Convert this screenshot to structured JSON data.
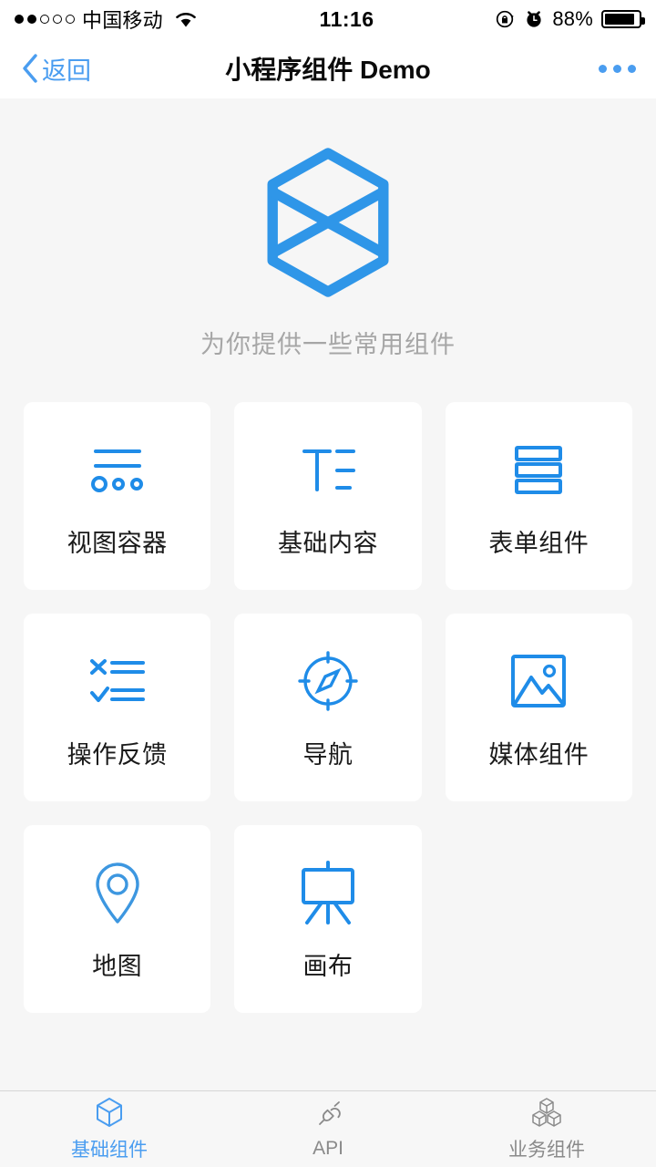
{
  "colors": {
    "accent": "#1f8ce8",
    "nav_link": "#4a9df0",
    "page_bg": "#f6f6f6",
    "card_bg": "#ffffff",
    "tagline": "#a6a6a6",
    "tab_inactive": "#8a8a8a"
  },
  "statusbar": {
    "signal_dots_filled": 2,
    "signal_dots_total": 5,
    "carrier": "中国移动",
    "wifi_icon": "wifi-icon",
    "time": "11:16",
    "rotation_lock_icon": "rotation-lock-icon",
    "alarm_icon": "alarm-clock-icon",
    "battery_percent": "88%",
    "battery_level": 88,
    "battery_icon": "battery-icon"
  },
  "navbar": {
    "back_icon": "chevron-left-icon",
    "back_label": "返回",
    "title": "小程序组件 Demo",
    "more_icon": "more-dots-icon"
  },
  "hero": {
    "logo_icon": "mini-program-components-logo",
    "tagline": "为你提供一些常用组件"
  },
  "grid": {
    "cards": [
      {
        "label": "视图容器",
        "icon": "view-container-icon"
      },
      {
        "label": "基础内容",
        "icon": "basic-content-icon"
      },
      {
        "label": "表单组件",
        "icon": "form-components-icon"
      },
      {
        "label": "操作反馈",
        "icon": "action-feedback-icon"
      },
      {
        "label": "导航",
        "icon": "navigation-compass-icon"
      },
      {
        "label": "媒体组件",
        "icon": "media-image-icon"
      },
      {
        "label": "地图",
        "icon": "map-pin-icon"
      },
      {
        "label": "画布",
        "icon": "canvas-easel-icon"
      }
    ]
  },
  "tabbar": {
    "tabs": [
      {
        "label": "基础组件",
        "icon": "cube-icon",
        "active": true
      },
      {
        "label": "API",
        "icon": "plug-connector-icon",
        "active": false
      },
      {
        "label": "业务组件",
        "icon": "stacked-cubes-icon",
        "active": false
      }
    ]
  }
}
